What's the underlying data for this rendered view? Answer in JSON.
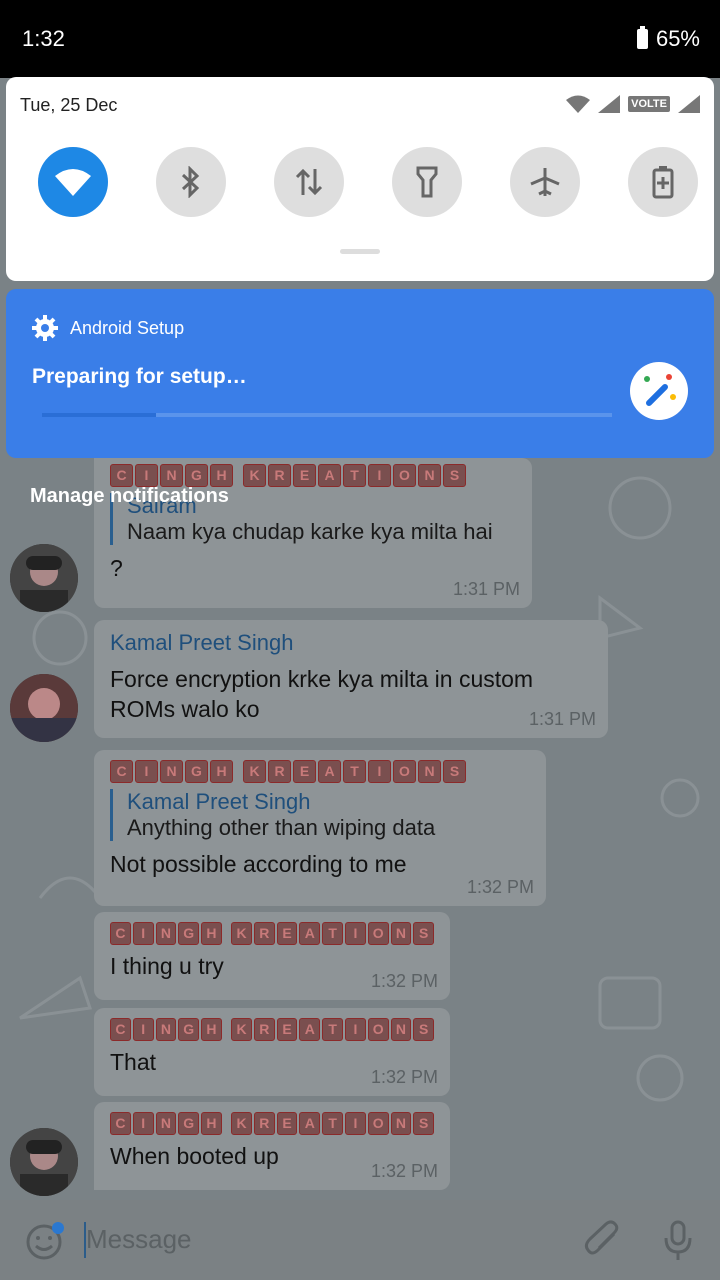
{
  "status_bar": {
    "time": "1:32",
    "battery": "65%"
  },
  "quick_settings": {
    "date": "Tue, 25 Dec",
    "volte": "VOLTE",
    "tiles": [
      "wifi-icon",
      "bluetooth-icon",
      "data-icon",
      "flashlight-icon",
      "airplane-icon",
      "battery-saver-icon"
    ]
  },
  "notification": {
    "app": "Android Setup",
    "message": "Preparing for setup…",
    "progress": 0.2
  },
  "manage": "Manage notifications",
  "tag_letters": [
    "C",
    "I",
    "N",
    "G",
    "H",
    "",
    "K",
    "R",
    "E",
    "A",
    "T",
    "I",
    "O",
    "N",
    "S"
  ],
  "messages": [
    {
      "reply_name": "Sairam",
      "reply_text": "Naam kya chudap karke kya milta hai",
      "text": "?",
      "time": "1:31 PM"
    },
    {
      "sender": "Kamal Preet Singh",
      "text": "Force encryption krke kya milta in custom ROMs walo ko",
      "time": "1:31 PM"
    },
    {
      "reply_name": "Kamal Preet Singh",
      "reply_text": "Anything other than wiping data",
      "text": "Not possible according to me",
      "time": "1:32 PM"
    },
    {
      "text": "I thing u try",
      "time": "1:32 PM"
    },
    {
      "text": "That",
      "time": "1:32 PM"
    },
    {
      "text": "When booted up",
      "time": "1:32 PM"
    }
  ],
  "input": {
    "placeholder": "Message"
  }
}
